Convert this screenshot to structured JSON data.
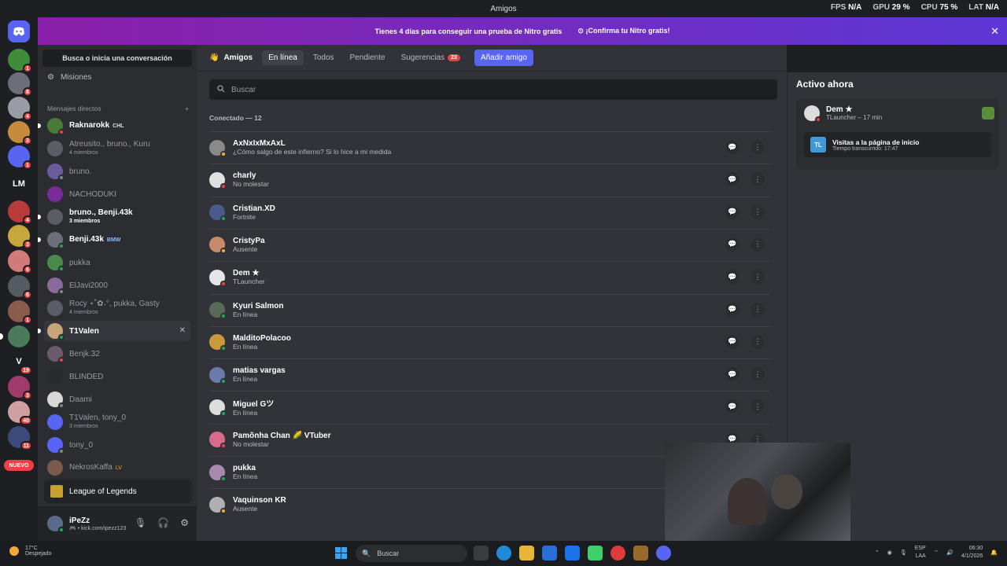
{
  "window": {
    "title": "Amigos"
  },
  "hud": {
    "fps_label": "FPS",
    "fps_val": "N/A",
    "gpu_label": "GPU",
    "gpu_val": "29 %",
    "cpu_label": "CPU",
    "cpu_val": "75 %",
    "lat_label": "LAT",
    "lat_val": "N/A"
  },
  "nitro": {
    "text": "Tienes 4 días para conseguir una prueba de Nitro gratis",
    "cta": "¡Confirma tu Nitro gratis!"
  },
  "servers": {
    "lm_label": "LM",
    "v_label": "V",
    "nuevo_label": "NUEVO",
    "badges": [
      "1",
      "8",
      "4",
      "3",
      "1",
      "4",
      "3",
      "6",
      "6",
      "1",
      "19",
      "3",
      "40",
      "11"
    ]
  },
  "sidebar": {
    "search": "Busca o inicia una conversación",
    "misiones": "Misiones",
    "dm_header": "Mensajes directos",
    "dms": [
      {
        "name": "Raknarokk",
        "tag": "CHL",
        "sub": ""
      },
      {
        "name": "Atreusito., bruno., Kuru",
        "tag": "",
        "sub": "4 miembros"
      },
      {
        "name": "bruno.",
        "tag": "",
        "sub": ""
      },
      {
        "name": "NACHODUKI",
        "tag": "",
        "sub": ""
      },
      {
        "name": "bruno., Benji.43k",
        "tag": "",
        "sub": "3 miembros"
      },
      {
        "name": "Benji.43k",
        "tag": "BMW",
        "sub": ""
      },
      {
        "name": "pukka",
        "tag": "",
        "sub": ""
      },
      {
        "name": "ElJavi2000",
        "tag": "",
        "sub": ""
      },
      {
        "name": "Rocy ⋆˚✿˖°, pukka, Gasty",
        "tag": "",
        "sub": "4 miembros"
      },
      {
        "name": "T1Valen",
        "tag": "",
        "sub": ""
      },
      {
        "name": "Benjk.32",
        "tag": "",
        "sub": ""
      },
      {
        "name": "BLINDED",
        "tag": "",
        "sub": ""
      },
      {
        "name": "Daami",
        "tag": "",
        "sub": ""
      },
      {
        "name": "T1Valen, tony_0",
        "tag": "",
        "sub": "3 miembros"
      },
      {
        "name": "tony_0",
        "tag": "",
        "sub": ""
      },
      {
        "name": "NekrosKaffa",
        "tag": "LV",
        "sub": ""
      }
    ]
  },
  "game_bar": {
    "label": "League of Legends"
  },
  "user": {
    "name": "iPeZz",
    "status": "kick.com/ipezz123"
  },
  "topnav": {
    "title": "Amigos",
    "tabs": [
      "En línea",
      "Todos",
      "Pendiente",
      "Sugerencias"
    ],
    "suggestions_count": "23",
    "add_friend": "Añadir amigo"
  },
  "search": {
    "placeholder": "Buscar"
  },
  "online_label": "Conectado — 12",
  "friends": [
    {
      "name": "AxNxIxMxAxL",
      "status": "¿Cómo salgo de este infierno? Si lo hice a mi medida",
      "color": "#f0b232"
    },
    {
      "name": "charly",
      "status": "No molestar",
      "color": "#f23f43"
    },
    {
      "name": "Cristian.XD",
      "status": "Fortnite",
      "color": "#23a55a"
    },
    {
      "name": "CristyPa",
      "status": "Ausente",
      "color": "#f0b232"
    },
    {
      "name": "Dem ★",
      "status": "TLauncher",
      "color": "#f23f43"
    },
    {
      "name": "Kyuri Salmon",
      "status": "En línea",
      "color": "#23a55a"
    },
    {
      "name": "MalditoPolacoo",
      "status": "En línea",
      "color": "#23a55a"
    },
    {
      "name": "matias vargas",
      "status": "En línea",
      "color": "#23a55a"
    },
    {
      "name": "Miguel Gツ",
      "status": "En línea",
      "color": "#23a55a"
    },
    {
      "name": "Pamõnha Chan 🌽 VTuber",
      "status": "No molestar",
      "color": "#f23f43"
    },
    {
      "name": "pukka",
      "status": "En línea",
      "color": "#23a55a"
    },
    {
      "name": "Vaquinson KR",
      "status": "Ausente",
      "color": "#f0b232"
    }
  ],
  "active_now": {
    "title": "Activo ahora",
    "user": "Dem ★",
    "activity": "TLauncher – 17 min",
    "icon_text": "TL",
    "detail": "Visitas a la página de inicio",
    "elapsed": "Tiempo transcurrido: 17:47"
  },
  "taskbar": {
    "temp": "17°C",
    "weather": "Despejado",
    "search": "Buscar",
    "lang": "ESP",
    "lang2": "LAA",
    "time": "06:30",
    "date": "4/1/2026"
  }
}
